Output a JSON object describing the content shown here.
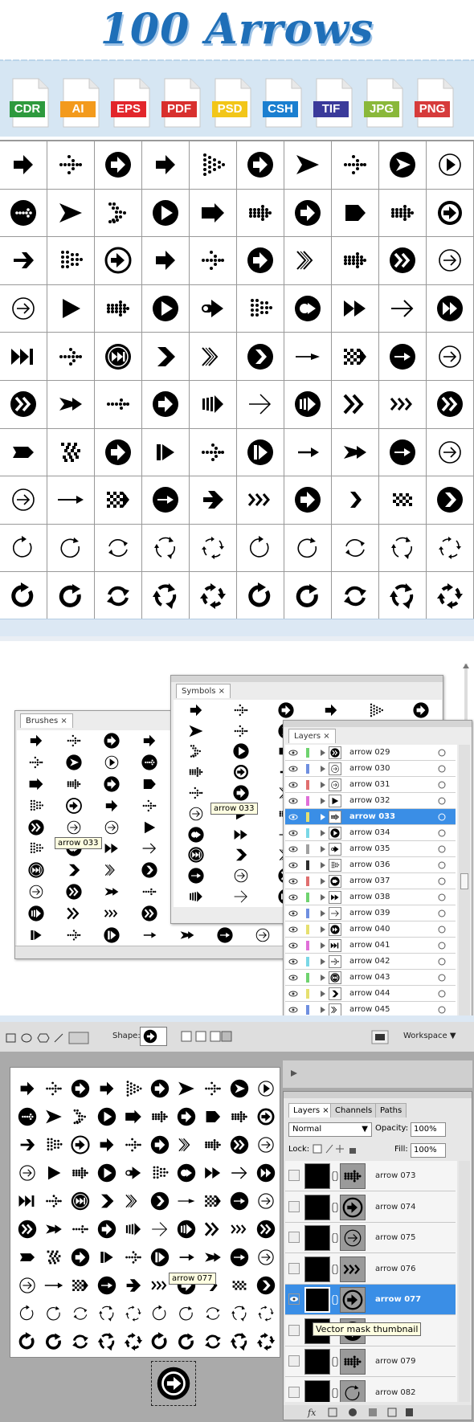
{
  "header": {
    "title": "100 Arrows"
  },
  "formats": [
    {
      "label": "CDR",
      "color": "#2e9a3e"
    },
    {
      "label": "AI",
      "color": "#f39a1c"
    },
    {
      "label": "EPS",
      "color": "#e2262b"
    },
    {
      "label": "PDF",
      "color": "#d8302e"
    },
    {
      "label": "PSD",
      "color": "#f2c619"
    },
    {
      "label": "CSH",
      "color": "#1b7fd0"
    },
    {
      "label": "TIF",
      "color": "#3a3a9a"
    },
    {
      "label": "JPG",
      "color": "#8ab83a"
    },
    {
      "label": "PNG",
      "color": "#d63b3b"
    }
  ],
  "illustrator": {
    "brushes_tab": "Brushes",
    "symbols_tab": "Symbols",
    "layers_tab": "Layers",
    "tooltip_brushes": "arrow 033",
    "tooltip_symbols": "arrow 033",
    "layers": [
      {
        "name": "arrow 029",
        "color": "#6fd36f",
        "selected": false
      },
      {
        "name": "arrow 030",
        "color": "#6f8fe0",
        "selected": false
      },
      {
        "name": "arrow 031",
        "color": "#e06f6f",
        "selected": false
      },
      {
        "name": "arrow 032",
        "color": "#e06fd8",
        "selected": false
      },
      {
        "name": "arrow 033",
        "color": "#e6e06f",
        "selected": true
      },
      {
        "name": "arrow 034",
        "color": "#7ad7e6",
        "selected": false
      },
      {
        "name": "arrow 035",
        "color": "#a0a0a0",
        "selected": false
      },
      {
        "name": "arrow 036",
        "color": "#2d2d2d",
        "selected": false
      },
      {
        "name": "arrow 037",
        "color": "#e06f6f",
        "selected": false
      },
      {
        "name": "arrow 038",
        "color": "#6fd36f",
        "selected": false
      },
      {
        "name": "arrow 039",
        "color": "#6f8fe0",
        "selected": false
      },
      {
        "name": "arrow 040",
        "color": "#e6e06f",
        "selected": false
      },
      {
        "name": "arrow 041",
        "color": "#e06fd8",
        "selected": false
      },
      {
        "name": "arrow 042",
        "color": "#7ad7e6",
        "selected": false
      },
      {
        "name": "arrow 043",
        "color": "#6fd36f",
        "selected": false
      },
      {
        "name": "arrow 044",
        "color": "#e6e06f",
        "selected": false
      },
      {
        "name": "arrow 045",
        "color": "#6f8fe0",
        "selected": false
      }
    ]
  },
  "photoshop": {
    "shape_label": "Shape:",
    "workspace_label": "Workspace",
    "tabs": [
      "Layers",
      "Channels",
      "Paths"
    ],
    "blend_mode": "Normal",
    "opacity_label": "Opacity:",
    "opacity_value": "100%",
    "lock_label": "Lock:",
    "fill_label": "Fill:",
    "fill_value": "100%",
    "canvas_tooltip": "arrow 077",
    "layer_tooltip": "Vector mask thumbnail",
    "layers": [
      {
        "name": "arrow 073",
        "selected": false,
        "visible": false
      },
      {
        "name": "arrow 074",
        "selected": false,
        "visible": false
      },
      {
        "name": "arrow 075",
        "selected": false,
        "visible": false
      },
      {
        "name": "arrow 076",
        "selected": false,
        "visible": false
      },
      {
        "name": "arrow 077",
        "selected": true,
        "visible": true
      },
      {
        "name": "arrow 078",
        "selected": false,
        "visible": false
      },
      {
        "name": "arrow 079",
        "selected": false,
        "visible": false
      },
      {
        "name": "arrow 082",
        "selected": false,
        "visible": false
      }
    ]
  },
  "icons": [
    "arrow-solid",
    "arrow-dotted",
    "arrow-circle-filled",
    "arrow-solid",
    "arrow-dotted-triangle",
    "arrow-circle-filled",
    "arrow-dart",
    "arrow-dotted",
    "arrow-circle-dart",
    "arrow-circle-outline-play",
    "arrow-circle-dotted",
    "arrow-dart",
    "arrow-dotted-chevron",
    "arrow-circle-play",
    "arrow-block",
    "arrow-dotted-block",
    "arrow-circle-filled",
    "arrow-pentagon",
    "arrow-dotted-block",
    "arrow-circle-outline-thick",
    "arrow-solid-thin",
    "arrow-dotted-lines",
    "arrow-circle-outline-arrow",
    "arrow-solid",
    "arrow-dotted",
    "arrow-circle-filled",
    "arrow-chevron-double-outline",
    "arrow-dotted-block",
    "arrow-circle-chevron-double",
    "arrow-circle-outline-thin",
    "arrow-circle-outline-thin",
    "arrow-triangle",
    "arrow-dotted-block",
    "arrow-circle-play",
    "arrow-toggle",
    "arrow-dotted-lines",
    "arrow-circle-toggle",
    "arrow-fastforward",
    "arrow-line",
    "arrow-circle-fastforward",
    "arrow-skip",
    "arrow-dotted-thin",
    "arrow-circle-skip",
    "arrow-chevron",
    "arrow-chevron-double-outline",
    "arrow-circle-chevron",
    "arrow-line-thin",
    "arrow-checkered",
    "arrow-circle-line",
    "arrow-circle-outline-thin",
    "arrow-circle-chevron-double",
    "arrow-feather",
    "arrow-dotted-small",
    "arrow-circle-filled",
    "arrow-stripes",
    "arrow-line-chevron",
    "arrow-circle-stripes",
    "arrow-chevron-double",
    "arrow-chevron-triple",
    "arrow-circle-chevron-double",
    "arrow-tag",
    "arrow-checkered-chevron",
    "arrow-circle-filled",
    "arrow-bar-play",
    "arrow-dotted-thin",
    "arrow-circle-bar-play",
    "arrow-line-small",
    "arrow-feather",
    "arrow-circle-line",
    "arrow-circle-outline-thin",
    "arrow-circle-outline-thin",
    "arrow-line-long",
    "arrow-checkered",
    "arrow-circle-line",
    "arrow-solid-bold",
    "arrow-chevron-triple",
    "arrow-circle-filled",
    "arrow-chevron-small",
    "arrow-checkered-small",
    "arrow-circle-chevron",
    "refresh-open",
    "refresh-circle",
    "refresh-double",
    "refresh-triple",
    "refresh-quad",
    "refresh-open",
    "refresh-circle",
    "refresh-double",
    "refresh-triple",
    "refresh-quad",
    "refresh-open-bold",
    "refresh-circle-bold",
    "refresh-double-bold",
    "refresh-triple-bold",
    "refresh-quad-bold",
    "refresh-open-bold",
    "refresh-circle-bold",
    "refresh-double-bold",
    "refresh-triple-bold",
    "refresh-quad-bold"
  ]
}
